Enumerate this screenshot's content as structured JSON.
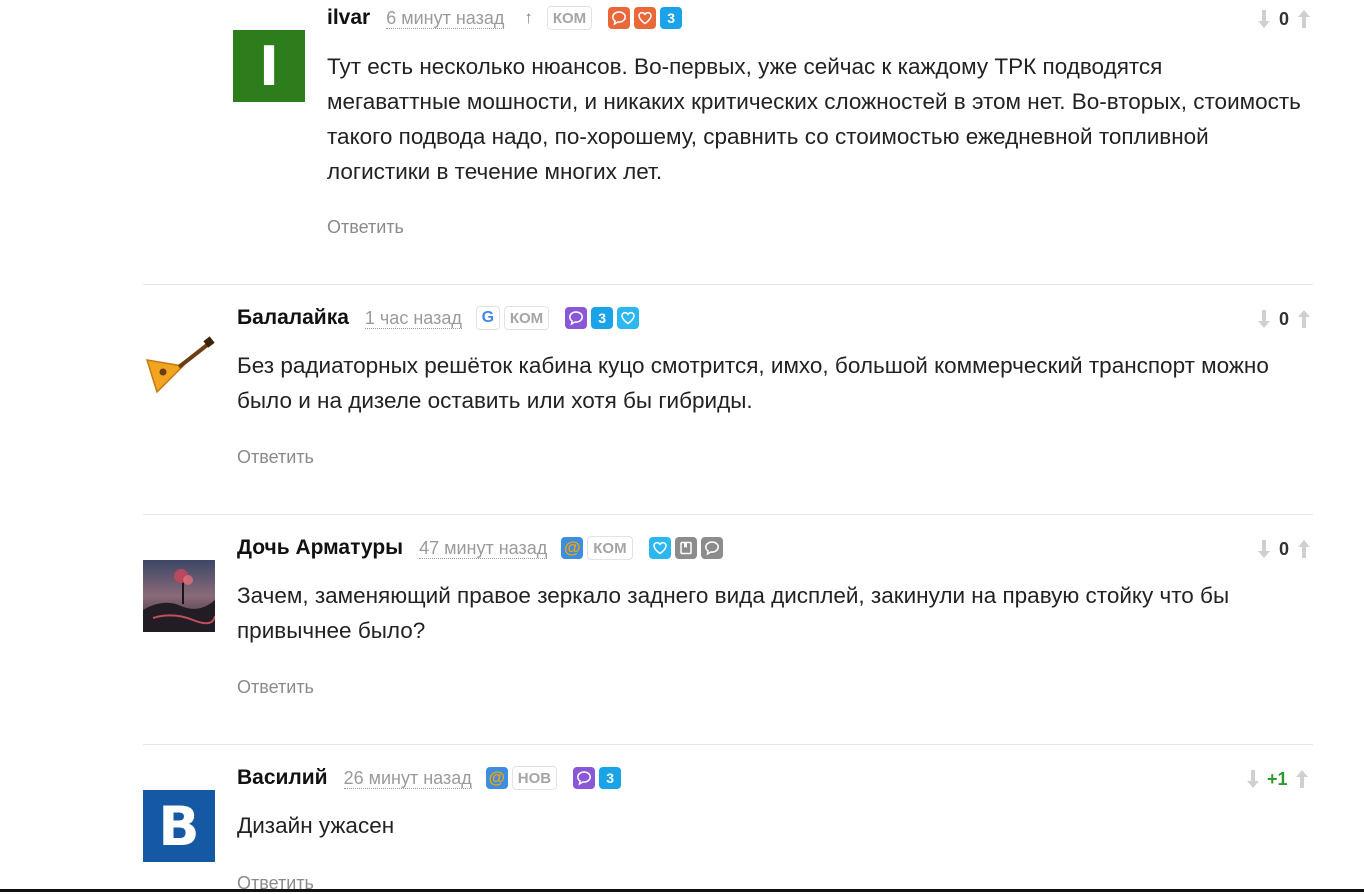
{
  "comments": [
    {
      "author": "ilvar",
      "avatar_letter": "I",
      "avatar_color": "#2e7d1c",
      "time": "6 минут назад",
      "tag": "КОМ",
      "badge_count": "3",
      "text": "Тут есть несколько нюансов. Во-первых, уже сейчас к каждому ТРК подводятся мегаваттные мошности, и никаких критических сложностей в этом нет. Во-вторых, стоимость такого подвода надо, по-хорошему, сравнить со стоимостью ежедневной топливной логистики в течение многих лет.",
      "reply": "Ответить",
      "score": "0"
    },
    {
      "author": "Балалайка",
      "time": "1 час назад",
      "provider_icon": "google-icon",
      "tag": "КОМ",
      "badge_count": "3",
      "text": "Без радиаторных решёток кабина куцо смотрится, имхо, большой коммерческий транспорт можно было и на дизеле оставить или хотя бы гибриды.",
      "reply": "Ответить",
      "score": "0"
    },
    {
      "author": "Дочь Арматуры",
      "time": "47 минут назад",
      "provider_icon": "mail-at-icon",
      "tag": "КОМ",
      "text": "Зачем, заменяющий правое зеркало заднего вида дисплей, закинули на правую стойку что бы привычнее было?",
      "reply": "Ответить",
      "score": "0"
    },
    {
      "author": "Василий",
      "avatar_letter": "B",
      "avatar_color": "#1558a4",
      "time": "26 минут назад",
      "provider_icon": "mail-at-icon",
      "tag": "НОВ",
      "badge_count": "3",
      "text": "Дизайн ужасен",
      "reply": "Ответить",
      "score": "+1"
    }
  ],
  "icons": {
    "mail_glyph": "@",
    "google_glyph": "G",
    "upvote_small": "↑"
  },
  "colors": {
    "orange": "#e8683a",
    "purple": "#8a57d6",
    "blue": "#1aa3e8",
    "light_blue": "#2bb8f0",
    "gray": "#8c8c8c",
    "positive": "#2e9a2e"
  }
}
